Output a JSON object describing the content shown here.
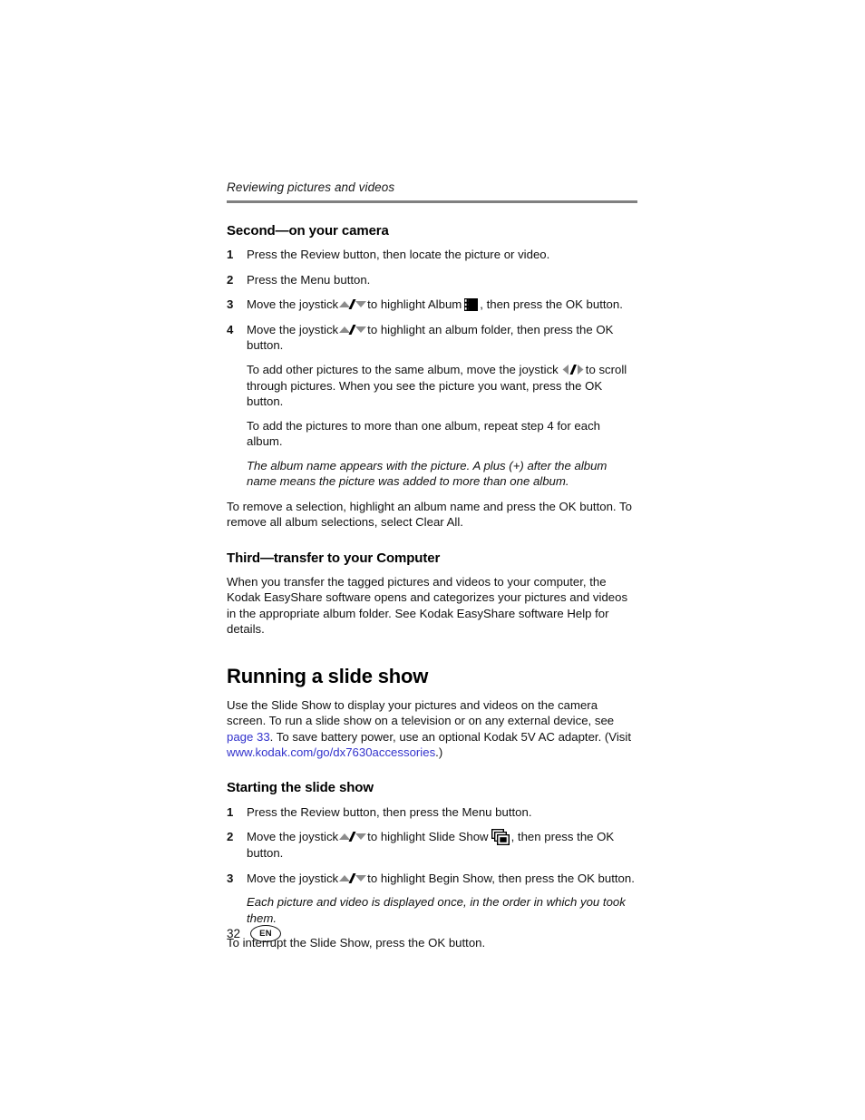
{
  "running_head": "Reviewing pictures and videos",
  "sections": [
    {
      "heading": "Second—on your camera",
      "steps": [
        {
          "num": "1",
          "text": "Press the Review button, then locate the picture or video."
        },
        {
          "num": "2",
          "text": "Press the Menu button."
        },
        {
          "num": "3",
          "pre": "Move the joystick",
          "mid": "to highlight Album",
          "post": ", then press the OK button."
        },
        {
          "num": "4",
          "pre": "Move the joystick",
          "mid": "to highlight an album folder, then press the OK button.",
          "sub": [
            {
              "pre": "To add other pictures to the same album, move the joystick",
              "post": "to scroll through pictures. When you see the picture you want, press the OK button."
            },
            {
              "text": "To add the pictures to more than one album, repeat step 4 for each album."
            },
            {
              "italic": "The album name appears with the picture. A plus (+) after the album name means the picture was added to more than one album."
            }
          ]
        }
      ],
      "closing": "To remove a selection, highlight an album name and press the OK button. To remove all album selections, select Clear All."
    },
    {
      "heading": "Third—transfer to your Computer",
      "paragraph": "When you transfer the tagged pictures and videos to your computer, the Kodak EasyShare software opens and categorizes your pictures and videos in the appropriate album folder. See Kodak EasyShare software Help for details."
    }
  ],
  "chapter": {
    "title": "Running a slide show",
    "intro_part1": "Use the Slide Show to display your pictures and videos on the camera screen. To run a slide show on a television or on any external device, see ",
    "intro_link_page": "page 33",
    "intro_part2": ". To save battery power, use an optional Kodak 5V AC adapter. (Visit ",
    "intro_link_url": "www.kodak.com/go/dx7630accessories",
    "intro_part3": ".)",
    "subheading": "Starting the slide show",
    "steps": [
      {
        "num": "1",
        "text": "Press the Review button, then press the Menu button."
      },
      {
        "num": "2",
        "pre": "Move the joystick",
        "mid": "to highlight Slide Show",
        "post": ", then press the OK button."
      },
      {
        "num": "3",
        "pre": "Move the joystick",
        "mid": "to highlight Begin Show, then press the OK button.",
        "note": "Each picture and video is displayed once, in the order in which you took them."
      }
    ],
    "closing": "To interrupt the Slide Show, press the OK button."
  },
  "footer": {
    "page_number": "32",
    "language": "EN"
  },
  "colors": {
    "link": "#3333cc",
    "rule": "#808080",
    "arrow_gray": "#8c8c8c",
    "text": "#111111"
  },
  "icons": {
    "up_down_joystick": "up-down-arrows-icon",
    "left_right_joystick": "left-right-arrows-icon",
    "album": "album-icon",
    "slide_show": "slide-show-icon"
  }
}
